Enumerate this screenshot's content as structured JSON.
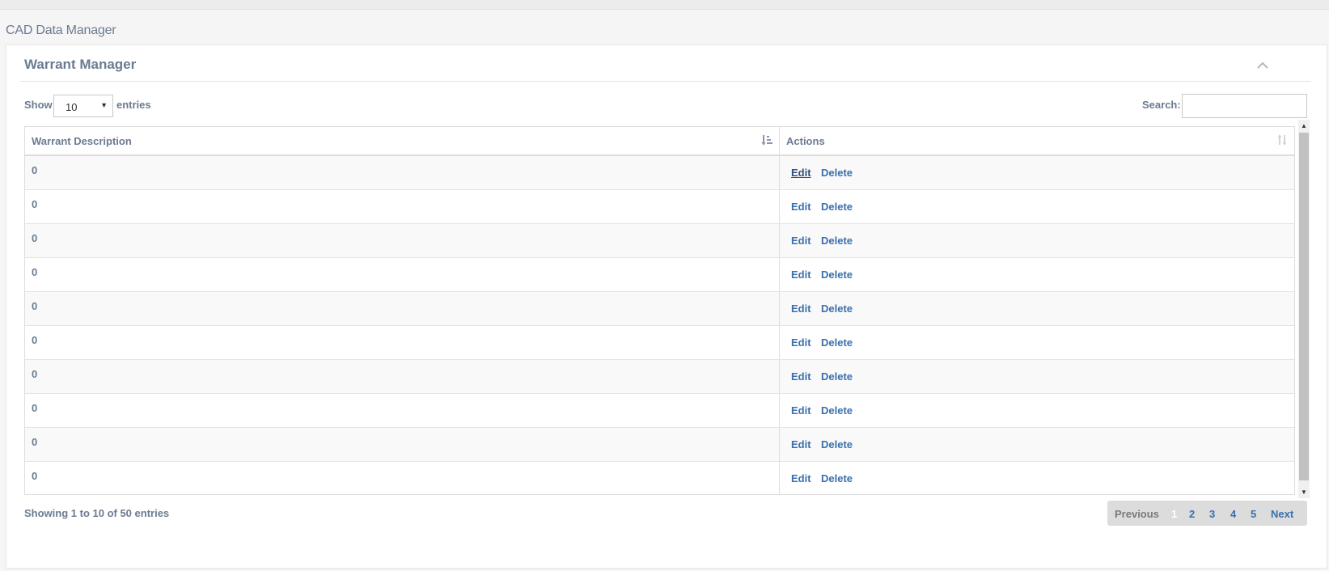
{
  "app": {
    "title": "CAD Data Manager"
  },
  "panel": {
    "title": "Warrant Manager"
  },
  "length_control": {
    "show_label": "Show",
    "selected": "10",
    "entries_label": "entries"
  },
  "search": {
    "label": "Search:",
    "value": "",
    "placeholder": ""
  },
  "table": {
    "columns": [
      "Warrant Description",
      "Actions"
    ],
    "rows": [
      {
        "description": "0",
        "edit": "Edit",
        "delete": "Delete"
      },
      {
        "description": "0",
        "edit": "Edit",
        "delete": "Delete"
      },
      {
        "description": "0",
        "edit": "Edit",
        "delete": "Delete"
      },
      {
        "description": "0",
        "edit": "Edit",
        "delete": "Delete"
      },
      {
        "description": "0",
        "edit": "Edit",
        "delete": "Delete"
      },
      {
        "description": "0",
        "edit": "Edit",
        "delete": "Delete"
      },
      {
        "description": "0",
        "edit": "Edit",
        "delete": "Delete"
      },
      {
        "description": "0",
        "edit": "Edit",
        "delete": "Delete"
      },
      {
        "description": "0",
        "edit": "Edit",
        "delete": "Delete"
      },
      {
        "description": "0",
        "edit": "Edit",
        "delete": "Delete"
      }
    ]
  },
  "info": "Showing 1 to 10 of 50 entries",
  "pagination": {
    "previous": "Previous",
    "pages": [
      "1",
      "2",
      "3",
      "4",
      "5"
    ],
    "current": "1",
    "next": "Next"
  },
  "icons": {
    "collapse": "chevron-up-icon",
    "sort_active": "sort-amount-icon",
    "sort_inactive": "sort-both-icon",
    "select_caret": "caret-down-icon"
  },
  "colors": {
    "text": "#6b7b91",
    "link": "#3a6fad",
    "pagination_bg": "#dcdcdc"
  }
}
